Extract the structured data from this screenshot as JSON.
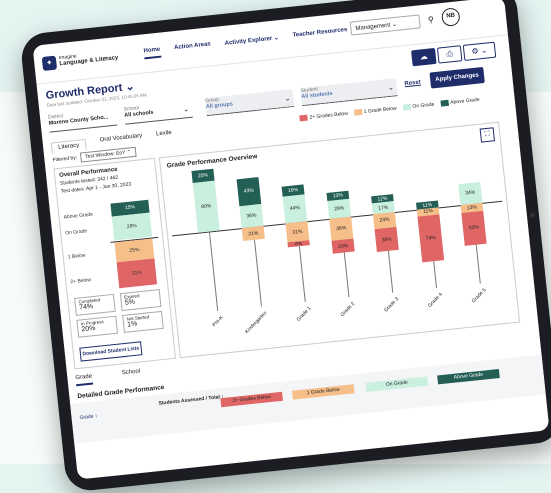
{
  "colors": {
    "navy": "#1f2d6b",
    "gradesBelow": "#e06666",
    "gradeBelow": "#f6bf8a",
    "onGrade": "#c9efdf",
    "aboveGrade": "#235f55"
  },
  "nav": {
    "brand_small": "Imagine",
    "brand": "Language & Literacy",
    "links": [
      "Home",
      "Action Areas",
      "Activity Explorer ⌄",
      "Teacher Resources"
    ],
    "management": "Management ⌄",
    "avatar": "NB"
  },
  "header": {
    "title": "Growth Report ⌄",
    "updated": "Data last updated: October 31, 2023, 10:45:05 AM"
  },
  "filters": {
    "district_label": "District",
    "district_value": "Moreno County Scho...",
    "school_label": "School",
    "school_value": "All schools",
    "group_label": "Group",
    "group_value": "All groups",
    "student_label": "Student",
    "student_value": "All students",
    "reset": "Reset",
    "apply": "Apply Changes"
  },
  "subtabs": [
    "Literacy",
    "Oral Vocabulary",
    "Lexile"
  ],
  "legend": [
    "2+ Grades Below",
    "1 Grade Below",
    "On Grade",
    "Above Grade"
  ],
  "filter_by": {
    "label": "Filtered by:",
    "value": "Test Window: EoY ⌃"
  },
  "overall": {
    "title": "Overall Performance",
    "tested": "Students tested: 342 / 462",
    "dates": "Test dates: Apr 1 - Jun 30, 2023",
    "bands": [
      {
        "label": "Above Grade",
        "value": "15%"
      },
      {
        "label": "On Grade",
        "value": "28%"
      },
      {
        "label": "1 Below",
        "value": "25%"
      },
      {
        "label": "2+ Below",
        "value": "31%"
      }
    ],
    "stats": [
      {
        "label": "Completed",
        "value": "74%"
      },
      {
        "label": "Expired",
        "value": "5%"
      },
      {
        "label": "In Progress",
        "value": "20%"
      },
      {
        "label": "Not Started",
        "value": "1%"
      }
    ],
    "download": "Download Student Lists"
  },
  "chart_title": "Grade Performance Overview",
  "chart_data": {
    "type": "bar",
    "stacked": true,
    "categories": [
      "Pre-K",
      "Kindergarten",
      "Grade 1",
      "Grade 2",
      "Grade 3",
      "Grade 4",
      "Grade 5"
    ],
    "series": [
      {
        "name": "Above Grade",
        "values": [
          20,
          43,
          16,
          13,
          12,
          11,
          0
        ]
      },
      {
        "name": "On Grade",
        "values": [
          80,
          36,
          44,
          29,
          17,
          0,
          34
        ]
      },
      {
        "name": "1 Grade Below",
        "values": [
          0,
          21,
          31,
          36,
          24,
          11,
          13
        ]
      },
      {
        "name": "2+ Grades Below",
        "values": [
          0,
          0,
          8,
          20,
          38,
          74,
          53
        ]
      }
    ]
  },
  "bottom": {
    "tabs": [
      "Grade",
      "School"
    ],
    "section": "Detailed Grade Performance",
    "col_grade": "Grade ↕",
    "col_students": "Students Assessed / Total ↕",
    "cols": [
      "2+ Grades Below",
      "1 Grade Below",
      "On Grade",
      "Above Grade"
    ]
  }
}
